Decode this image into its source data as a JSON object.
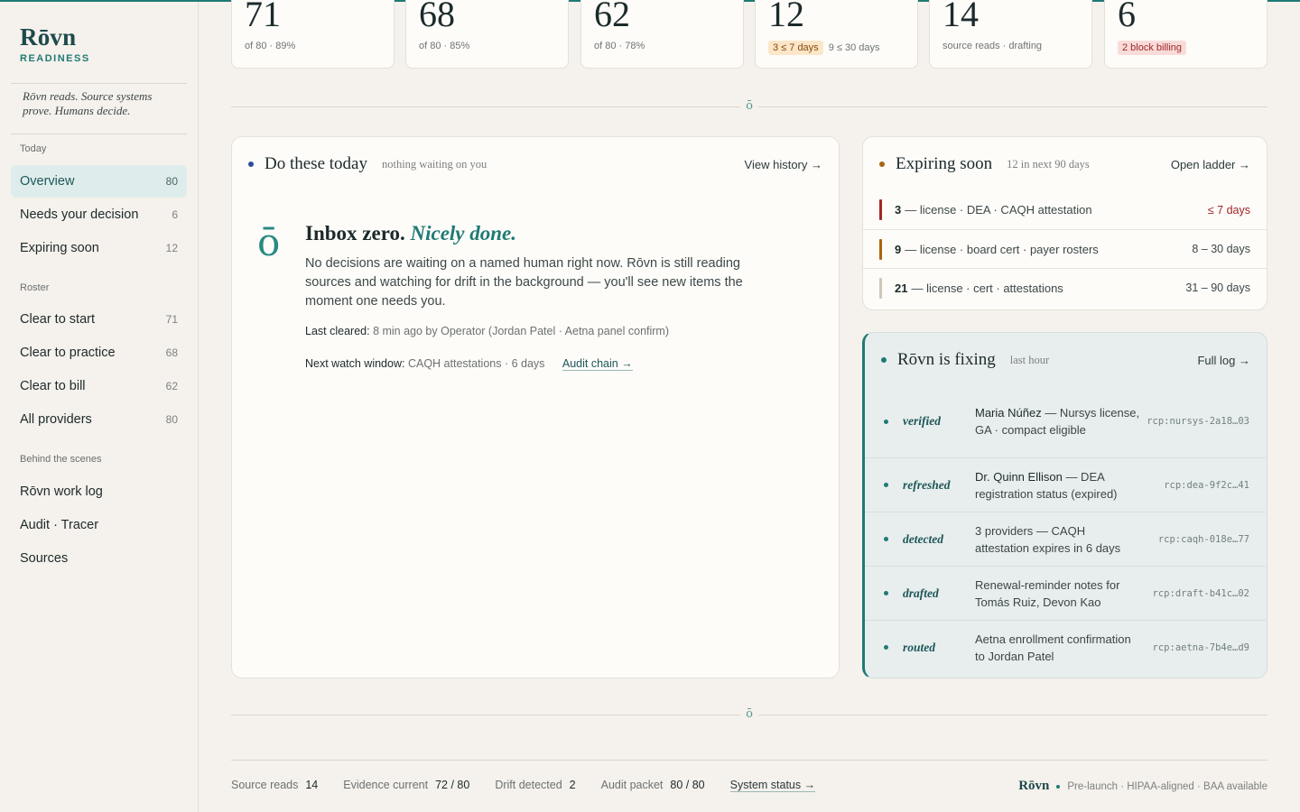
{
  "brand": {
    "name": "Rōvn",
    "sub": "READINESS",
    "tagline": "Rōvn reads. Source systems prove. Humans decide."
  },
  "sidebar": {
    "sections": [
      {
        "label": "Today"
      },
      {
        "label": "Roster"
      },
      {
        "label": "Behind the scenes"
      }
    ],
    "items": [
      {
        "label": "Overview",
        "count": "80"
      },
      {
        "label": "Needs your decision",
        "count": "6"
      },
      {
        "label": "Expiring soon",
        "count": "12"
      },
      {
        "label": "Clear to start",
        "count": "71"
      },
      {
        "label": "Clear to practice",
        "count": "68"
      },
      {
        "label": "Clear to bill",
        "count": "62"
      },
      {
        "label": "All providers",
        "count": "80"
      },
      {
        "label": "Rōvn work log"
      },
      {
        "label": "Audit · Tracer"
      },
      {
        "label": "Sources"
      }
    ]
  },
  "stats": [
    {
      "value": "71",
      "sub": "of 80 · 89%"
    },
    {
      "value": "68",
      "sub": "of 80 · 85%"
    },
    {
      "value": "62",
      "sub": "of 80 · 78%"
    },
    {
      "value": "12",
      "chip": "3 ≤ 7 days",
      "sub": "9 ≤ 30 days"
    },
    {
      "value": "14",
      "sub": "source reads · drafting"
    },
    {
      "value": "6",
      "chip": "2 block billing"
    }
  ],
  "divider_glyph": "ō",
  "today": {
    "title": "Do these today",
    "note": "nothing waiting on you",
    "link": "View history →",
    "glyph": "ō",
    "headline": "Inbox zero.",
    "headline_em": "Nicely done.",
    "body": "No decisions are waiting on a named human right now. Rōvn is still reading sources and watching for drift in the background — you'll see new items the moment one needs you.",
    "last_label": "Last cleared:",
    "last_value": "8 min ago by Operator (Jordan Patel · Aetna panel confirm)",
    "next_label": "Next watch window:",
    "next_value": "CAQH attestations · 6 days",
    "audit_link": "Audit chain →"
  },
  "expiring": {
    "title": "Expiring soon",
    "note": "12 in next 90 days",
    "link": "Open ladder →",
    "rows": [
      {
        "num": "3",
        "text": "— license · DEA · CAQH attestation",
        "when": "≤ 7 days",
        "color": "#a12727"
      },
      {
        "num": "9",
        "text": "— license · board cert · payer rosters",
        "when": "8 – 30 days",
        "color": "#a8650f"
      },
      {
        "num": "21",
        "text": "— license · cert · attestations",
        "when": "31 – 90 days",
        "color": "#cfc6b8"
      }
    ]
  },
  "fixing": {
    "title": "Rōvn is fixing",
    "note": "last hour",
    "link": "Full log →",
    "rows": [
      {
        "verb": "verified",
        "who": "Maria Núñez",
        "text": " — Nursys license, GA · compact eligible",
        "ref": "rcp:nursys-2a18…03"
      },
      {
        "verb": "refreshed",
        "who": "Dr. Quinn Ellison",
        "text": " — DEA registration status (expired)",
        "ref": "rcp:dea-9f2c…41"
      },
      {
        "verb": "detected",
        "who": "",
        "text": "3 providers — CAQH attestation expires in 6 days",
        "ref": "rcp:caqh-018e…77"
      },
      {
        "verb": "drafted",
        "who": "",
        "text": "Renewal-reminder notes for Tomás Ruiz, Devon Kao",
        "ref": "rcp:draft-b41c…02"
      },
      {
        "verb": "routed",
        "who": "",
        "text": "Aetna enrollment confirmation to Jordan Patel",
        "ref": "rcp:aetna-7b4e…d9"
      }
    ]
  },
  "footer": {
    "stats": [
      {
        "label": "Source reads",
        "value": "14"
      },
      {
        "label": "Evidence current",
        "value": "72 / 80"
      },
      {
        "label": "Drift detected",
        "value": "2"
      },
      {
        "label": "Audit packet",
        "value": "80 / 80"
      }
    ],
    "status_link": "System status →",
    "brand": "Rōvn",
    "brand_note": "Pre-launch · HIPAA-aligned · BAA available"
  },
  "colors": {
    "accent": "#1f7a74",
    "today_dot": "#2a4f9a",
    "expiring_dot": "#a8650f"
  }
}
